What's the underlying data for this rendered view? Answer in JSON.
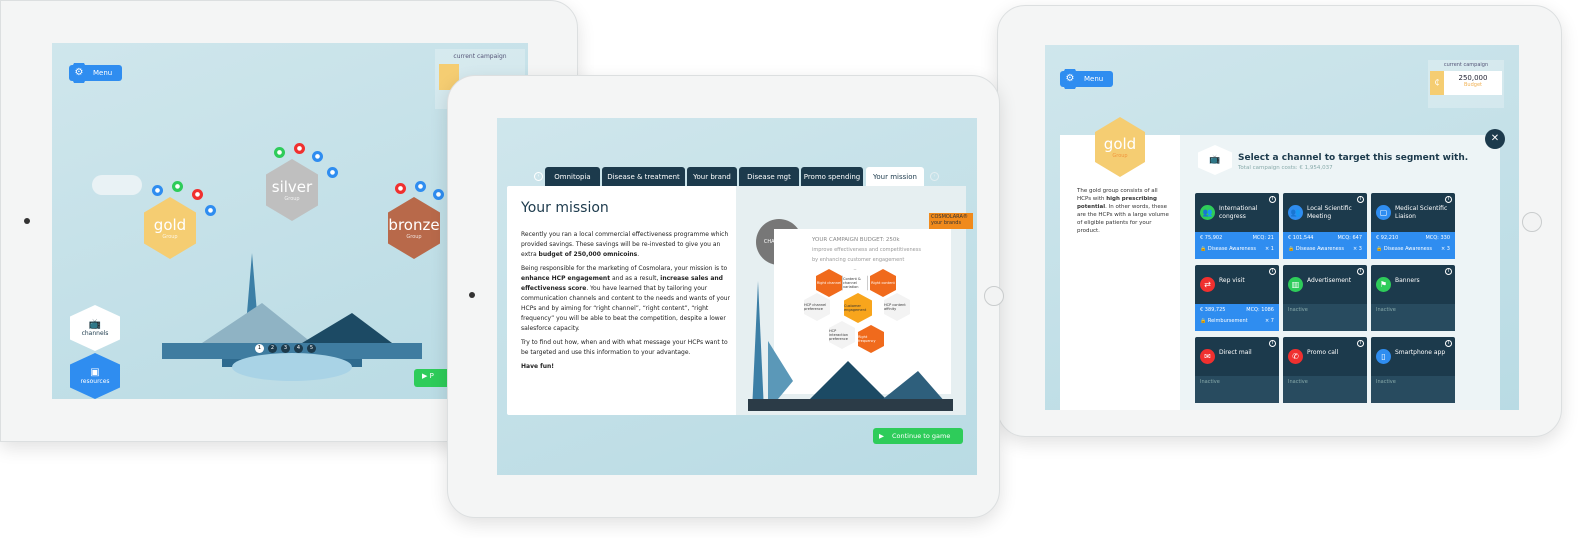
{
  "left_tablet": {
    "menu_label": "Menu",
    "campaign_label": "current campaign",
    "groups": [
      {
        "name": "gold",
        "sub": "Group",
        "color": "#f5cd72"
      },
      {
        "name": "silver",
        "sub": "Group",
        "color": "#bfbfbf"
      },
      {
        "name": "bronze",
        "sub": "Group",
        "color": "#b8694a"
      }
    ],
    "channels_label": "channels",
    "resources_label": "resources",
    "pages": [
      "1",
      "2",
      "3",
      "4",
      "5"
    ],
    "play_label": "P"
  },
  "center_tablet": {
    "tabs": [
      "Omnitopia",
      "Disease & treatment",
      "Your brand",
      "Disease mgt",
      "Promo spending",
      "Your mission"
    ],
    "active_tab": "Your mission",
    "title": "Your mission",
    "p1_a": "Recently you ran a local commercial effectiveness programme which provided savings. These savings will be re-invested to give you an extra ",
    "p1_b": "budget of 250,000 omnicoins",
    "p1_c": ".",
    "p2_a": "Being responsible for the marketing of Cosmolara, your mission is to ",
    "p2_b": "enhance HCP engagement",
    "p2_c": " and as a result, ",
    "p2_d": "increase sales and effectiveness score",
    "p2_e": ". You have learned that by tailoring your communication channels and content to the needs and wants of your HCPs and by aiming for “right channel”, “right content”, “right frequency” you will be able to beat the competition, despite a lower salesforce capacity.",
    "p3": "Try to find out how, when and with what message your HCPs want to be targeted and use this information to your advantage.",
    "p4": "Have fun!",
    "illustration": {
      "badge": "CHALLENGE",
      "brand": "COSMOLARA®",
      "brand_sub": "your brands",
      "budget": "YOUR CAMPAIGN BUDGET: 250k",
      "bullets": [
        "improve effectiveness and competitiveness",
        "by enhancing customer engagement"
      ],
      "hexes": [
        "Right channel",
        "Content & channel variation",
        "Right content",
        "HCP channel preference",
        "Customer engagement",
        "HCP content affinity",
        "HCP interaction preference",
        "Right frequency"
      ]
    },
    "continue_label": "Continue to game"
  },
  "right_tablet": {
    "menu_label": "Menu",
    "campaign_label": "current campaign",
    "budget_value": "250,000",
    "budget_label": "Budget",
    "segment": {
      "name": "gold",
      "sub": "Group"
    },
    "desc_a": "The gold group consists of all HCPs with ",
    "desc_b": "high prescribing potential",
    "desc_c": ". In other words, these are the HCPs with a large volume of eligible patients for your product.",
    "heading": "Select a channel to target this segment with.",
    "subheading": "Total campaign costs: € 1,954,037",
    "cards": [
      {
        "name": "International congress",
        "icon": "people-icon",
        "color": "#2ecc5a",
        "cost": "€ 75,902",
        "mcq": "MCQ: 21",
        "tag": "Disease Awareness",
        "count": "× 1"
      },
      {
        "name": "Local Scientific Meeting",
        "icon": "people-icon",
        "color": "#2f8df0",
        "cost": "€ 101,544",
        "mcq": "MCQ: 647",
        "tag": "Disease Awareness",
        "count": "× 3"
      },
      {
        "name": "Medical Scientific Liaison",
        "icon": "clipboard-icon",
        "color": "#2f8df0",
        "cost": "€ 92,210",
        "mcq": "MCQ: 330",
        "tag": "Disease Awareness",
        "count": "× 3"
      },
      {
        "name": "Rep visit",
        "icon": "handshake-icon",
        "color": "#f0302f",
        "cost": "€ 389,725",
        "mcq": "MCQ: 1086",
        "tag": "Reimbursement",
        "count": "× 7"
      },
      {
        "name": "Advertisement",
        "icon": "book-icon",
        "color": "#2ecc5a",
        "status": "Inactive"
      },
      {
        "name": "Banners",
        "icon": "flag-icon",
        "color": "#2ecc5a",
        "status": "Inactive"
      },
      {
        "name": "Direct mail",
        "icon": "mail-icon",
        "color": "#f0302f",
        "status": "Inactive"
      },
      {
        "name": "Promo call",
        "icon": "phone-icon",
        "color": "#f0302f",
        "status": "Inactive"
      },
      {
        "name": "Smartphone app",
        "icon": "phone-device-icon",
        "color": "#2f8df0",
        "status": "Inactive"
      }
    ]
  }
}
